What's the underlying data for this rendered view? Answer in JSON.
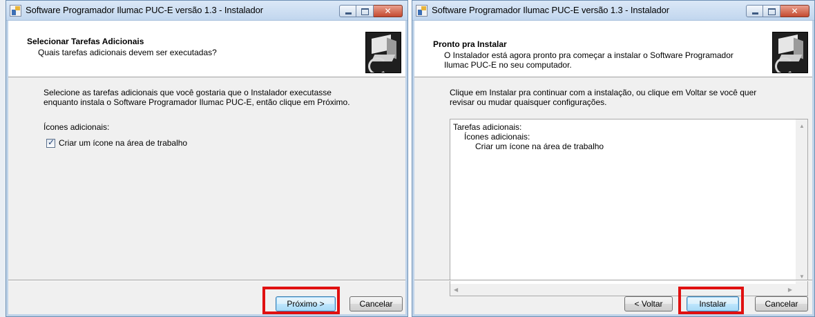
{
  "windows": [
    {
      "title": "Software Programador Ilumac PUC-E versão 1.3 - Instalador",
      "header_title": "Selecionar Tarefas Adicionais",
      "header_subtitle": "Quais tarefas adicionais devem ser executadas?",
      "body_line1": "Selecione as tarefas adicionais que você gostaria que o Instalador executasse",
      "body_line2": "enquanto instala o Software Programador Ilumac PUC-E, então clique em Próximo.",
      "icons_label": "Ícones adicionais:",
      "checkbox_label": "Criar um ícone na área de trabalho",
      "checkbox_checked": true,
      "next_button": "Próximo >",
      "cancel_button": "Cancelar"
    },
    {
      "title": "Software Programador Ilumac PUC-E versão 1.3 - Instalador",
      "header_title": "Pronto pra Instalar",
      "header_subtitle_line1": "O Instalador está agora pronto pra começar a instalar o Software Programador",
      "header_subtitle_line2": "Ilumac PUC-E no seu computador.",
      "body_line1": "Clique em Instalar pra continuar com a instalação, ou clique em Voltar se você quer",
      "body_line2": "revisar ou mudar quaisquer configurações.",
      "summary_line1": "Tarefas adicionais:",
      "summary_line2": "Ícones adicionais:",
      "summary_line3": "Criar um ícone na área de trabalho",
      "back_button": "< Voltar",
      "install_button": "Instalar",
      "cancel_button": "Cancelar"
    }
  ],
  "colors": {
    "highlight": "#e01010",
    "titlebar": "#c1d6ee",
    "window_bg": "#f0f0f0"
  }
}
